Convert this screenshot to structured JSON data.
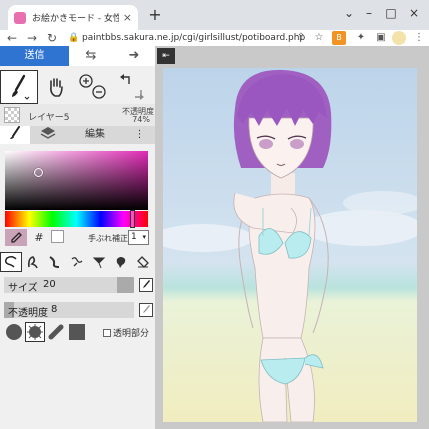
{
  "browser": {
    "tab_title": "お絵かきモード - 女性キャラお絵かき",
    "tab_close": "×",
    "new_tab": "+",
    "url": "paintbbs.sakura.ne.jp/cgi/girlsillust/potiboard.php",
    "window_controls": [
      "⌄",
      "–",
      "□",
      "×"
    ]
  },
  "page_tabs": {
    "submit_label": "送信",
    "swap_icon": "⇆",
    "next_icon": "➜"
  },
  "layer": {
    "name": "レイヤー5",
    "opacity_label": "不透明度",
    "opacity_value": "74%"
  },
  "subtabs": {
    "brush_icon": "brush-icon",
    "layers_icon": "layers-icon",
    "edit_label": "編集",
    "more": "⋮"
  },
  "color": {
    "hash_label": "#",
    "stabilizer_label": "手ぶれ補正",
    "stabilizer_value": "1"
  },
  "size": {
    "label": "サイズ",
    "value": "20",
    "fill_fraction": 0.87
  },
  "opacity_slider": {
    "label": "不透明度",
    "value": "8",
    "fill_fraction": 0.08
  },
  "transparent": {
    "label": "透明部分"
  },
  "canvas": {
    "collapse_icon": "⇤"
  },
  "colors": {
    "accent": "#2f74d0",
    "current_color": "#c9a3b8"
  }
}
